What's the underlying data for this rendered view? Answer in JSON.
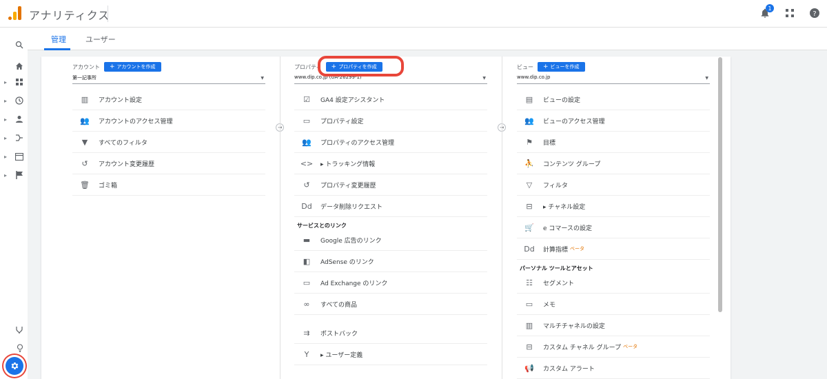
{
  "header": {
    "app_title": "アナリティクス",
    "notification_count": "1",
    "icons": [
      "notifications-icon",
      "apps-grid-icon",
      "help-icon"
    ]
  },
  "sidebar": {
    "items": [
      {
        "name": "search-icon",
        "glyph": "⌕"
      },
      {
        "name": "home-icon",
        "glyph": "⌂"
      },
      {
        "name": "dashboard-icon",
        "glyph": "▦"
      },
      {
        "name": "realtime-icon",
        "glyph": "◷"
      },
      {
        "name": "audience-icon",
        "glyph": "☻"
      },
      {
        "name": "acquisition-icon",
        "glyph": "⤳"
      },
      {
        "name": "behavior-icon",
        "glyph": "▤"
      },
      {
        "name": "conversions-icon",
        "glyph": "⚑"
      }
    ],
    "bottom": [
      {
        "name": "attribution-icon",
        "glyph": "⤭"
      },
      {
        "name": "discover-icon",
        "glyph": "♀"
      }
    ]
  },
  "tabs": [
    {
      "label": "管理",
      "active": true
    },
    {
      "label": "ユーザー",
      "active": false
    }
  ],
  "account": {
    "label": "アカウント",
    "create_button": "アカウントを作成",
    "selected": "第一記事所",
    "items": [
      {
        "label": "アカウント設定",
        "icon": "building-icon",
        "glyph": "▥"
      },
      {
        "label": "アカウントのアクセス管理",
        "icon": "people-icon",
        "glyph": "👥"
      },
      {
        "label": "すべてのフィルタ",
        "icon": "filter-icon",
        "glyph": "▼"
      },
      {
        "label": "アカウント変更履歴",
        "icon": "history-icon",
        "glyph": "↺"
      },
      {
        "label": "ゴミ箱",
        "icon": "trash-icon",
        "glyph": "🗑"
      }
    ]
  },
  "property": {
    "label": "プロパティ",
    "create_button": "プロパティを作成",
    "selected": "www.dip.co.jp (UA-26299-1)",
    "items": [
      {
        "label": "GA4 設定アシスタント",
        "icon": "checkbox-icon",
        "glyph": "☑"
      },
      {
        "label": "プロパティ設定",
        "icon": "settings-panel-icon",
        "glyph": "▭"
      },
      {
        "label": "プロパティのアクセス管理",
        "icon": "people-icon",
        "glyph": "👥"
      },
      {
        "label": "▸ トラッキング情報",
        "icon": "code-icon",
        "glyph": "<>"
      },
      {
        "label": "プロパティ変更履歴",
        "icon": "history-icon",
        "glyph": "↺"
      },
      {
        "label": "データ削除リクエスト",
        "icon": "dd-icon",
        "glyph": "Dd"
      }
    ],
    "section_label": "サービスとのリンク",
    "link_items": [
      {
        "label": "Google 広告のリンク",
        "icon": "google-ads-icon",
        "glyph": "▬"
      },
      {
        "label": "AdSense のリンク",
        "icon": "adsense-icon",
        "glyph": "◧"
      },
      {
        "label": "Ad Exchange のリンク",
        "icon": "ad-exchange-icon",
        "glyph": "▭"
      },
      {
        "label": "すべての商品",
        "icon": "all-products-icon",
        "glyph": "∞"
      },
      {
        "label": "ポストバック",
        "icon": "postback-icon",
        "glyph": "⇉"
      },
      {
        "label": "▸ ユーザー定義",
        "icon": "custom-definition-icon",
        "glyph": "Y"
      }
    ]
  },
  "view": {
    "label": "ビュー",
    "create_button": "ビューを作成",
    "selected": "www.dip.co.jp",
    "items": [
      {
        "label": "ビューの設定",
        "icon": "document-icon",
        "glyph": "▤"
      },
      {
        "label": "ビューのアクセス管理",
        "icon": "people-icon",
        "glyph": "👥"
      },
      {
        "label": "目標",
        "icon": "flag-icon",
        "glyph": "⚑"
      },
      {
        "label": "コンテンツ グループ",
        "icon": "content-group-icon",
        "glyph": "⛹"
      },
      {
        "label": "フィルタ",
        "icon": "filter-icon",
        "glyph": "▽"
      },
      {
        "label": "▸ チャネル設定",
        "icon": "channel-icon",
        "glyph": "⊟"
      },
      {
        "label": "e コマースの設定",
        "icon": "cart-icon",
        "glyph": "🛒"
      },
      {
        "label": "計算指標",
        "icon": "dd-icon",
        "glyph": "Dd",
        "beta": "ベータ"
      }
    ],
    "section_label": "パーソナル ツールとアセット",
    "tool_items": [
      {
        "label": "セグメント",
        "icon": "segment-icon",
        "glyph": "☷"
      },
      {
        "label": "メモ",
        "icon": "annotation-icon",
        "glyph": "▭"
      },
      {
        "label": "マルチチャネルの設定",
        "icon": "bar-chart-icon",
        "glyph": "▥"
      },
      {
        "label": "カスタム チャネル グループ",
        "icon": "channel-icon",
        "glyph": "⊟",
        "beta": "ベータ"
      },
      {
        "label": "カスタム アラート",
        "icon": "megaphone-icon",
        "glyph": "📢"
      }
    ]
  },
  "colors": {
    "accent": "#1a73e8",
    "highlight": "#e8463a",
    "analytics_orange": "#e37400"
  }
}
